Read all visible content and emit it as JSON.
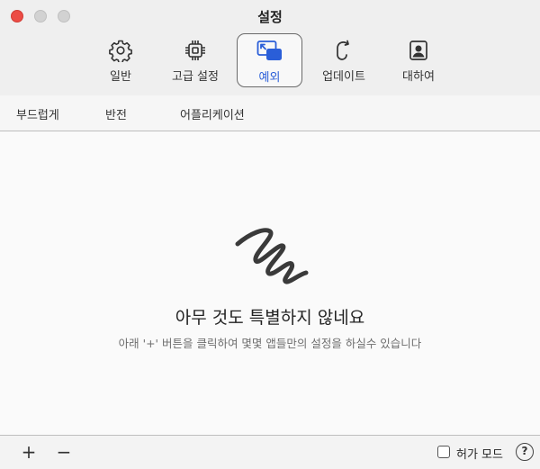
{
  "window": {
    "title": "설정"
  },
  "toolbar": {
    "items": [
      {
        "label": "일반",
        "icon": "gear-icon"
      },
      {
        "label": "고급 설정",
        "icon": "chip-icon"
      },
      {
        "label": "예외",
        "icon": "window-overlap-icon",
        "active": true
      },
      {
        "label": "업데이트",
        "icon": "refresh-icon"
      },
      {
        "label": "대하여",
        "icon": "person-icon"
      }
    ]
  },
  "subtabs": {
    "items": [
      "부드럽게",
      "반전",
      "어플리케이션"
    ]
  },
  "empty_state": {
    "icon": "scribble-icon",
    "title": "아무 것도 특별하지 않네요",
    "subtitle": "아래 '+' 버튼을 클릭하여 몇몇 앱들만의 설정을 하실수 있습니다"
  },
  "bottom": {
    "add_label": "+",
    "remove_label": "−",
    "permission_mode_label": "허가 모드",
    "help_label": "?"
  },
  "colors": {
    "accent": "#2a5ed8",
    "close": "#ec4c45"
  }
}
